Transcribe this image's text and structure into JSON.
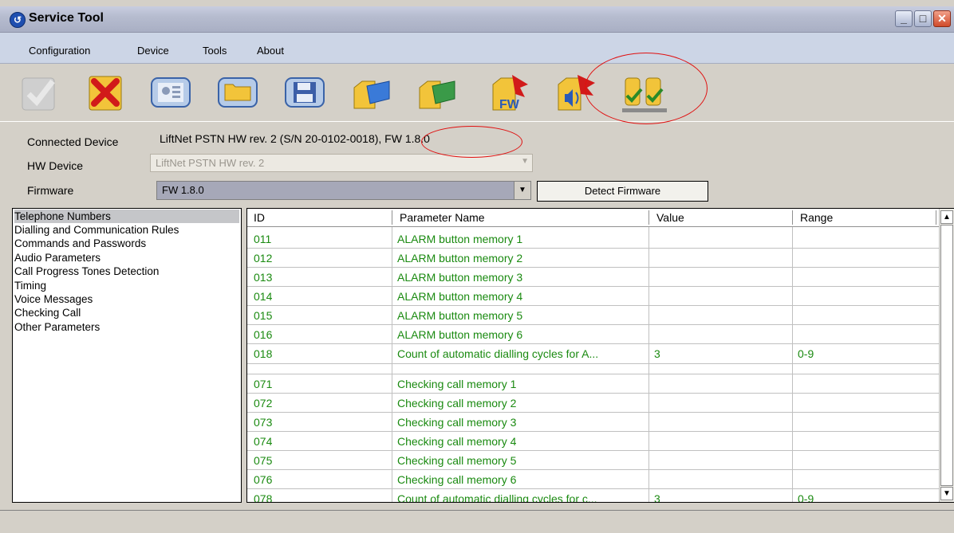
{
  "window": {
    "title": "Service Tool"
  },
  "menu": {
    "items": [
      "Configuration",
      "Device",
      "Tools",
      "About"
    ]
  },
  "toolbar": {
    "buttons": [
      {
        "icon": "checkmark-disabled-icon",
        "enabled": false
      },
      {
        "icon": "disconnect-icon",
        "enabled": true
      },
      {
        "icon": "settings-monitor-icon",
        "enabled": true
      },
      {
        "icon": "open-folder-icon",
        "enabled": true
      },
      {
        "icon": "save-disk-icon",
        "enabled": true
      },
      {
        "icon": "upload-to-device-icon",
        "enabled": true
      },
      {
        "icon": "download-from-device-icon",
        "enabled": true
      },
      {
        "icon": "firmware-update-icon",
        "enabled": true,
        "badge": "FW"
      },
      {
        "icon": "audio-update-icon",
        "enabled": true
      },
      {
        "icon": "traffic-light-check-icon",
        "enabled": true
      }
    ]
  },
  "device": {
    "connected_label": "Connected Device",
    "connected_value": "LiftNet PSTN HW rev. 2 (S/N 20-0102-0018), FW 1.8.0",
    "hw_label": "HW Device",
    "hw_value": "LiftNet PSTN HW rev. 2",
    "fw_label": "Firmware",
    "fw_value": "FW 1.8.0",
    "detect_button": "Detect Firmware"
  },
  "categories": [
    "Telephone Numbers",
    "Dialling and Communication Rules",
    "Commands and Passwords",
    "Audio Parameters",
    "Call Progress Tones Detection",
    "Timing",
    "Voice Messages",
    "Checking Call",
    "Other Parameters"
  ],
  "selected_category": "Telephone Numbers",
  "grid": {
    "columns": [
      "ID",
      "Parameter Name",
      "Value",
      "Range"
    ],
    "rows": [
      {
        "id": "011",
        "name": "ALARM button memory 1",
        "value": "",
        "range": ""
      },
      {
        "id": "012",
        "name": "ALARM button memory 2",
        "value": "",
        "range": ""
      },
      {
        "id": "013",
        "name": "ALARM button memory 3",
        "value": "",
        "range": ""
      },
      {
        "id": "014",
        "name": "ALARM button memory 4",
        "value": "",
        "range": ""
      },
      {
        "id": "015",
        "name": "ALARM button memory 5",
        "value": "",
        "range": ""
      },
      {
        "id": "016",
        "name": "ALARM button memory 6",
        "value": "",
        "range": ""
      },
      {
        "id": "018",
        "name": "Count of automatic dialling cycles for A...",
        "value": "3",
        "range": "0-9"
      },
      {
        "id": "",
        "name": "",
        "value": "",
        "range": ""
      },
      {
        "id": "071",
        "name": "Checking call memory 1",
        "value": "",
        "range": ""
      },
      {
        "id": "072",
        "name": "Checking call memory 2",
        "value": "",
        "range": ""
      },
      {
        "id": "073",
        "name": "Checking call memory 3",
        "value": "",
        "range": ""
      },
      {
        "id": "074",
        "name": "Checking call memory 4",
        "value": "",
        "range": ""
      },
      {
        "id": "075",
        "name": "Checking call memory 5",
        "value": "",
        "range": ""
      },
      {
        "id": "076",
        "name": "Checking call memory 6",
        "value": "",
        "range": ""
      },
      {
        "id": "078",
        "name": "Count of automatic dialling cycles for c...",
        "value": "3",
        "range": "0-9"
      }
    ]
  },
  "colors": {
    "param_text": "#1a8a10",
    "annotation": "#e01010"
  }
}
